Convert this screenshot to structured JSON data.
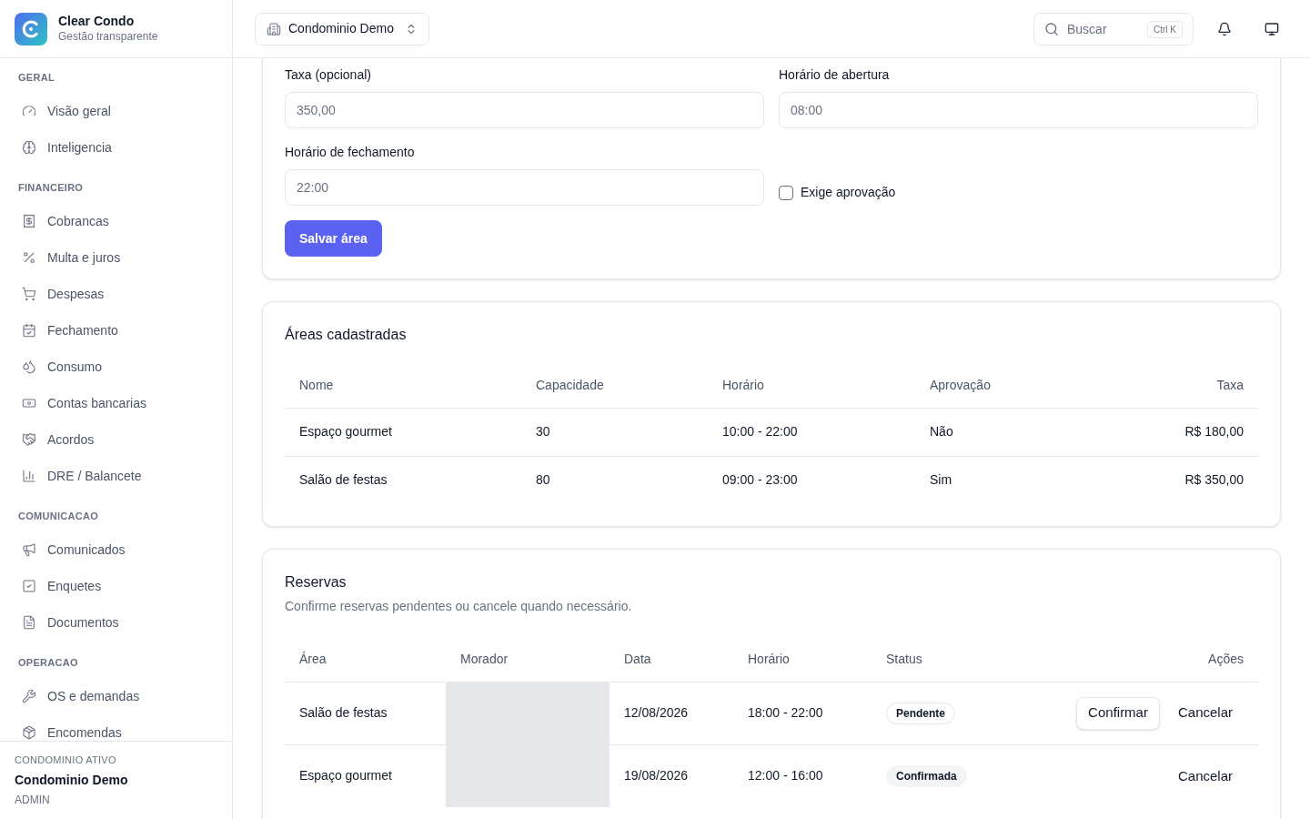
{
  "brand": {
    "name": "Clear Condo",
    "tagline": "Gestão transparente"
  },
  "sidebar": {
    "sections": [
      {
        "title": "GERAL",
        "items": [
          {
            "label": "Visão geral",
            "selected": false
          },
          {
            "label": "Inteligencia",
            "selected": false
          }
        ]
      },
      {
        "title": "FINANCEIRO",
        "items": [
          {
            "label": "Cobrancas",
            "selected": false
          },
          {
            "label": "Multa e juros",
            "selected": false
          },
          {
            "label": "Despesas",
            "selected": false
          },
          {
            "label": "Fechamento",
            "selected": false
          },
          {
            "label": "Consumo",
            "selected": false
          },
          {
            "label": "Contas bancarias",
            "selected": false
          },
          {
            "label": "Acordos",
            "selected": false
          },
          {
            "label": "DRE / Balancete",
            "selected": false
          }
        ]
      },
      {
        "title": "COMUNICACAO",
        "items": [
          {
            "label": "Comunicados",
            "selected": false
          },
          {
            "label": "Enquetes",
            "selected": false
          },
          {
            "label": "Documentos",
            "selected": false
          }
        ]
      },
      {
        "title": "OPERACAO",
        "items": [
          {
            "label": "OS e demandas",
            "selected": false
          },
          {
            "label": "Encomendas",
            "selected": false
          }
        ]
      }
    ],
    "footer": {
      "caption": "CONDOMINIO ATIVO",
      "name": "Condominio Demo",
      "role": "ADMIN"
    }
  },
  "header": {
    "condo_selector": "Condominio Demo",
    "search": {
      "placeholder": "Buscar",
      "shortcut": "Ctrl K"
    }
  },
  "area_form": {
    "fields": [
      {
        "label": "Taxa (opcional)",
        "placeholder": "350,00"
      },
      {
        "label": "Horário de abertura",
        "placeholder": "08:00"
      },
      {
        "label": "Horário de fechamento",
        "placeholder": "22:00"
      }
    ],
    "checkbox": {
      "label": "Exige aprovação",
      "checked": false
    },
    "submit": "Salvar área"
  },
  "areas": {
    "title": "Áreas cadastradas",
    "columns": [
      "Nome",
      "Capacidade",
      "Horário",
      "Aprovação",
      "Taxa"
    ],
    "rows": [
      [
        "Espaço gourmet",
        "30",
        "10:00 - 22:00",
        "Não",
        "R$ 180,00"
      ],
      [
        "Salão de festas",
        "80",
        "09:00 - 23:00",
        "Sim",
        "R$ 350,00"
      ]
    ]
  },
  "reservations": {
    "title": "Reservas",
    "subtitle": "Confirme reservas pendentes ou cancele quando necessário.",
    "columns": [
      "Área",
      "Morador",
      "Data",
      "Horário",
      "Status",
      "Ações"
    ],
    "rows": [
      {
        "area": "Salão de festas",
        "date": "12/08/2026",
        "time": "18:00 - 22:00",
        "status": {
          "label": "Pendente",
          "kind": "pending"
        },
        "actions": [
          {
            "label": "Confirmar",
            "kind": "outline"
          },
          {
            "label": "Cancelar",
            "kind": "ghost"
          }
        ]
      },
      {
        "area": "Espaço gourmet",
        "date": "19/08/2026",
        "time": "12:00 - 16:00",
        "status": {
          "label": "Confirmada",
          "kind": "confirmed"
        },
        "actions": [
          {
            "label": "Cancelar",
            "kind": "ghost"
          }
        ]
      }
    ]
  }
}
